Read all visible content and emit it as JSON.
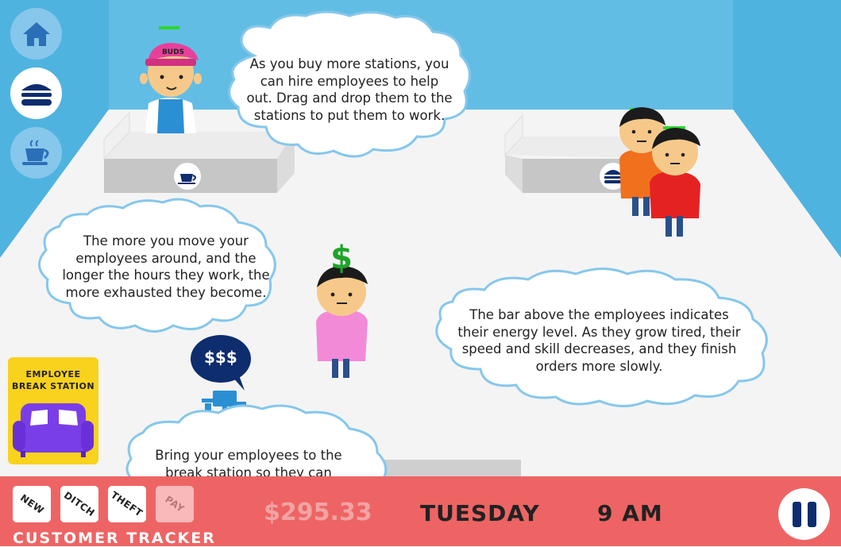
{
  "nav": [
    {
      "name": "home",
      "icon": "house-icon"
    },
    {
      "name": "burger",
      "icon": "burger-icon"
    },
    {
      "name": "coffee",
      "icon": "coffee-cup-icon"
    }
  ],
  "counter_left": {
    "hat_text": "BUDS",
    "station_icon": "coffee-cup-icon"
  },
  "counter_right": {
    "station_icon": "burger-icon"
  },
  "tips": {
    "hire": "As you buy more stations, you can hire employees to help out. Drag and drop them to the stations to put them to work.",
    "exhausted": "The more you move your employees around, and the longer the hours they work, the more exhausted they become.",
    "energy_bar": "The bar above the employees indicates their energy level. As they grow tired, their speed and skill decreases, and they finish orders more slowly.",
    "break": "Bring your employees to the break station so they can replenish their energy."
  },
  "employee_center": {
    "badge": "$"
  },
  "register_bubble": "$$$",
  "break_station": {
    "label": "EMPLOYEE BREAK STATION",
    "icon": "couch-icon"
  },
  "tracker": {
    "title": "CUSTOMER TRACKER",
    "buttons": [
      "NEW",
      "DITCH",
      "THEFT",
      "PAY"
    ]
  },
  "hud": {
    "money": "$295.33",
    "day": "TUESDAY",
    "time": "9 AM"
  },
  "colors": {
    "wall": "#62bde4",
    "floor": "#f4f4f4",
    "hud_bar": "#ee6464",
    "nav_dark": "#0e2d6e",
    "energy": "#2ed62e",
    "break_station": "#f8d21c",
    "couch": "#7a3ee8"
  }
}
